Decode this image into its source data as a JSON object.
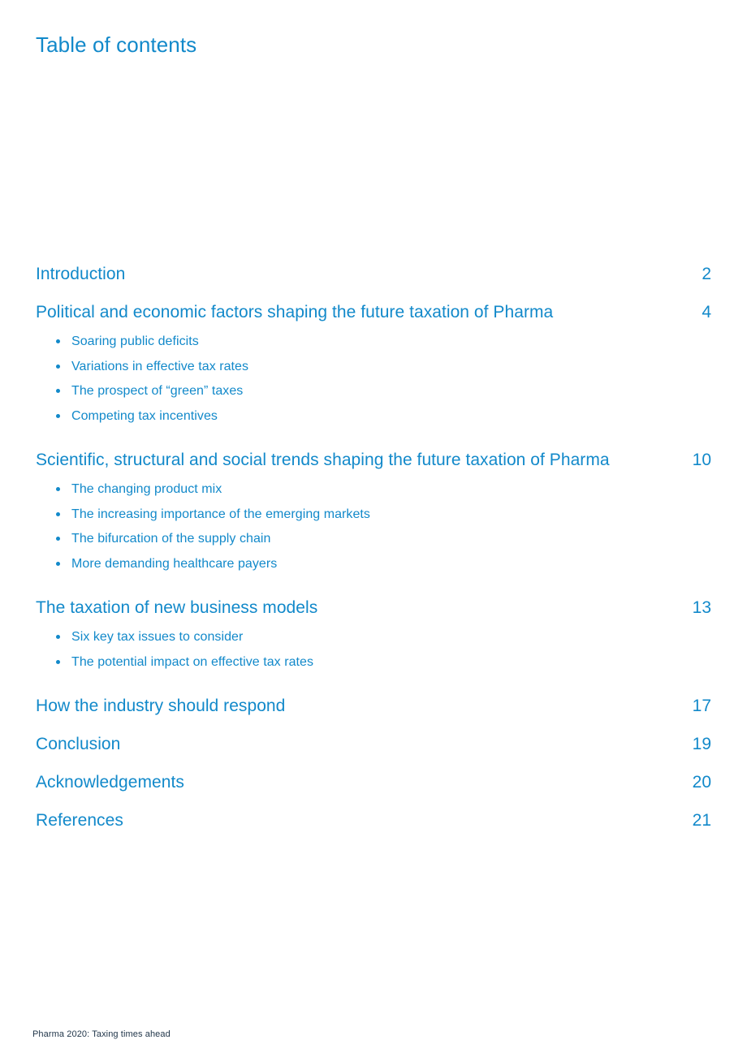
{
  "document": {
    "title": "Table of contents",
    "footer": "Pharma 2020: Taxing times ahead",
    "accent_color": "#1289ca",
    "footer_color": "#1f3448",
    "background_color": "#ffffff"
  },
  "toc": {
    "entries": [
      {
        "title": "Introduction",
        "page": "2",
        "subitems": []
      },
      {
        "title": "Political and economic factors shaping the future taxation of Pharma",
        "page": "4",
        "subitems": [
          "Soaring public deficits",
          "Variations in effective tax rates",
          "The prospect of “green” taxes",
          "Competing tax incentives"
        ]
      },
      {
        "title": "Scientific, structural and social trends shaping the future taxation of Pharma",
        "page": "10",
        "subitems": [
          "The changing product mix",
          "The increasing importance of the emerging markets",
          "The bifurcation of the supply chain",
          "More demanding healthcare payers"
        ]
      },
      {
        "title": "The taxation of new business models",
        "page": "13",
        "subitems": [
          "Six key tax issues to consider",
          "The potential impact on effective tax rates"
        ]
      },
      {
        "title": "How the industry should respond",
        "page": "17",
        "subitems": []
      },
      {
        "title": "Conclusion",
        "page": "19",
        "subitems": []
      },
      {
        "title": "Acknowledgements",
        "page": "20",
        "subitems": []
      },
      {
        "title": "References",
        "page": "21",
        "subitems": []
      }
    ]
  }
}
